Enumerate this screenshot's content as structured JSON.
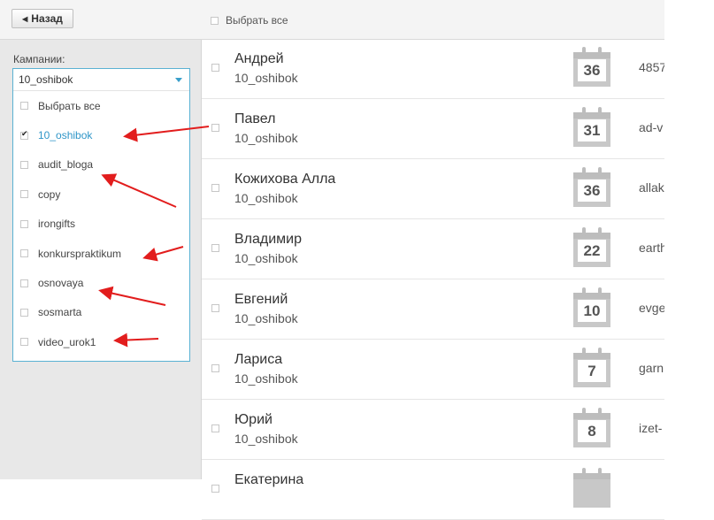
{
  "topbar": {
    "back_label": "Назад",
    "select_all_label": "Выбрать все"
  },
  "sidebar": {
    "campaigns_label": "Кампании:",
    "selected_value": "10_oshibok",
    "options": [
      {
        "label": "Выбрать все",
        "checked": false
      },
      {
        "label": "10_oshibok",
        "checked": true
      },
      {
        "label": "audit_bloga",
        "checked": false
      },
      {
        "label": "copy",
        "checked": false
      },
      {
        "label": "irongifts",
        "checked": false
      },
      {
        "label": "konkurspraktikum",
        "checked": false
      },
      {
        "label": "osnovaya",
        "checked": false
      },
      {
        "label": "sosmarta",
        "checked": false
      },
      {
        "label": "video_urok1",
        "checked": false
      }
    ]
  },
  "list": {
    "rows": [
      {
        "name": "Андрей",
        "campaign": "10_oshibok",
        "day": "36",
        "extra": "4857"
      },
      {
        "name": "Павел",
        "campaign": "10_oshibok",
        "day": "31",
        "extra": "ad-v"
      },
      {
        "name": "Кожихова Алла",
        "campaign": "10_oshibok",
        "day": "36",
        "extra": "allak"
      },
      {
        "name": "Владимир",
        "campaign": "10_oshibok",
        "day": "22",
        "extra": "earth"
      },
      {
        "name": "Евгений",
        "campaign": "10_oshibok",
        "day": "10",
        "extra": "evge"
      },
      {
        "name": "Лариса",
        "campaign": "10_oshibok",
        "day": "7",
        "extra": "garn"
      },
      {
        "name": "Юрий",
        "campaign": "10_oshibok",
        "day": "8",
        "extra": "izet-"
      },
      {
        "name": "Екатерина",
        "campaign": "",
        "day": "",
        "extra": ""
      }
    ]
  },
  "colors": {
    "accent": "#2f96c8",
    "annotation_arrow": "#e21d1d"
  }
}
